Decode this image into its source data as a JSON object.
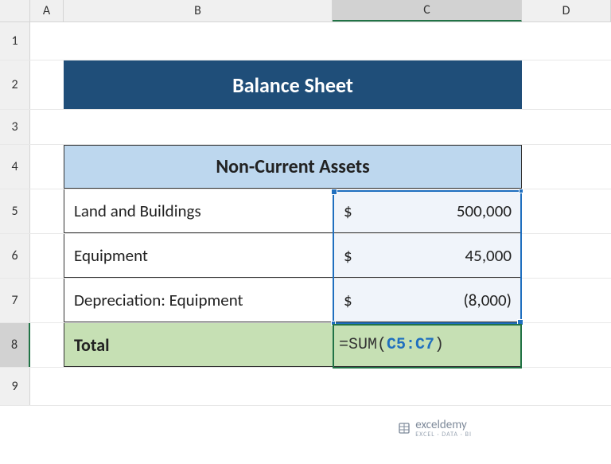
{
  "columns": [
    "A",
    "B",
    "C",
    "D"
  ],
  "rows": [
    "1",
    "2",
    "3",
    "4",
    "5",
    "6",
    "7",
    "8",
    "9"
  ],
  "activeColumn": "C",
  "activeRow": "8",
  "title": "Balance Sheet",
  "sectionHeader": "Non-Current Assets",
  "items": [
    {
      "label": "Land and Buildings",
      "currency": "$",
      "value": "500,000"
    },
    {
      "label": "Equipment",
      "currency": "$",
      "value": "45,000"
    },
    {
      "label": "Depreciation: Equipment",
      "currency": "$",
      "value": "(8,000)"
    }
  ],
  "totalLabel": "Total",
  "formula": {
    "prefix": "=SUM(",
    "ref": "C5:C7",
    "suffix": ")"
  },
  "watermark": {
    "name": "exceldemy",
    "tagline": "EXCEL · DATA · BI"
  }
}
